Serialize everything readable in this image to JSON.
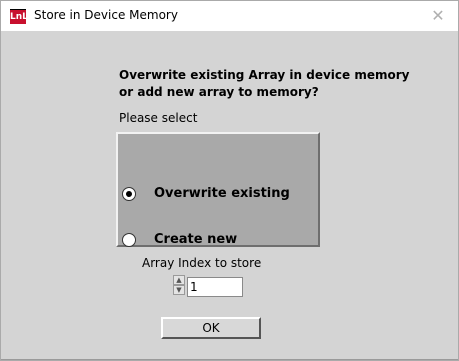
{
  "window": {
    "title": "Store in Device Memory",
    "app_icon_text": "LnL",
    "close_glyph": "✕"
  },
  "dialog": {
    "question_line1": "Overwrite existing Array in device memory",
    "question_line2": "or add new array to memory?",
    "prompt": "Please select",
    "options": [
      {
        "label": "Overwrite existing",
        "checked": true
      },
      {
        "label": "Create new",
        "checked": false
      }
    ],
    "index_label": "Array Index to store",
    "index_value": "1",
    "ok_label": "OK"
  },
  "colors": {
    "panel": "#a9a9a9",
    "client": "#d4d4d4",
    "brand": "#c8102e"
  }
}
